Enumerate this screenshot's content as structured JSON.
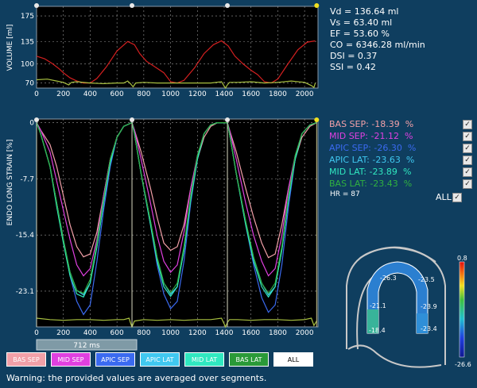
{
  "stats": [
    {
      "label": "Vd",
      "value": "136.64 ml"
    },
    {
      "label": "Vs",
      "value": "63.40 ml"
    },
    {
      "label": "EF",
      "value": "53.60 %"
    },
    {
      "label": "CO",
      "value": "6346.28 ml/min"
    },
    {
      "label": "DSI",
      "value": "0.37"
    },
    {
      "label": "SSI",
      "value": "0.42"
    }
  ],
  "segments": [
    {
      "name": "BAS SEP",
      "value": "-18.39",
      "unit": "%",
      "color": "#f2a0a8",
      "checked": true
    },
    {
      "name": "MID SEP",
      "value": "-21.12",
      "unit": "%",
      "color": "#e040e0",
      "checked": true
    },
    {
      "name": "APIC SEP",
      "value": "-26.30",
      "unit": "%",
      "color": "#3a6af0",
      "checked": true
    },
    {
      "name": "APIC LAT",
      "value": "-23.63",
      "unit": "%",
      "color": "#40c8f0",
      "checked": true
    },
    {
      "name": "MID LAT",
      "value": "-23.89",
      "unit": "%",
      "color": "#30e8c0",
      "checked": true
    },
    {
      "name": "BAS LAT",
      "value": "-23.43",
      "unit": "%",
      "color": "#30b040",
      "checked": true
    }
  ],
  "hr": "HR = 87",
  "all_label": "ALL",
  "check_glyph": "✓",
  "interval_label": "712 ms",
  "warning": "Warning: the provided values are averaged over segments.",
  "buttons": [
    {
      "label": "BAS SEP",
      "bg": "#f2a0a8",
      "fg": "#ffffff"
    },
    {
      "label": "MID SEP",
      "bg": "#e040e0",
      "fg": "#ffffff"
    },
    {
      "label": "APIC SEP",
      "bg": "#3a6af0",
      "fg": "#ffffff"
    },
    {
      "label": "APIC LAT",
      "bg": "#40c8f0",
      "fg": "#ffffff"
    },
    {
      "label": "MID LAT",
      "bg": "#30e8c0",
      "fg": "#ffffff"
    },
    {
      "label": "BAS LAT",
      "bg": "#2a9a38",
      "fg": "#ffffff"
    },
    {
      "label": "ALL",
      "bg": "#ffffff",
      "fg": "#000000"
    }
  ],
  "colorbar": {
    "max_label": "0.8",
    "min_label": "-26.6"
  },
  "bullseye_labels": {
    "sep": [
      "-26.3",
      "-21.1",
      "-18.4"
    ],
    "lat": [
      "-23.5",
      "-23.9",
      "-23.4"
    ]
  },
  "chart_data": [
    {
      "type": "line",
      "ylabel": "VOLUME [ml]",
      "xlim": [
        0,
        2100
      ],
      "ylim": [
        62,
        190
      ],
      "xticks": [
        0,
        200,
        400,
        600,
        800,
        1000,
        1200,
        1400,
        1600,
        1800,
        2000
      ],
      "yticks": [
        70,
        100,
        135,
        175
      ],
      "series": [
        {
          "name": "volume",
          "color": "#d42020",
          "x": [
            0,
            60,
            120,
            170,
            200,
            250,
            300,
            350,
            400,
            450,
            520,
            600,
            680,
            730,
            770,
            820,
            900,
            950,
            1000,
            1050,
            1100,
            1180,
            1250,
            1320,
            1380,
            1430,
            1480,
            1540,
            1600,
            1650,
            1700,
            1750,
            1800,
            1870,
            1950,
            2020,
            2080
          ],
          "values": [
            112,
            108,
            100,
            92,
            86,
            78,
            73,
            70,
            70,
            77,
            95,
            120,
            135,
            130,
            116,
            104,
            93,
            86,
            72,
            70,
            74,
            94,
            116,
            130,
            136,
            128,
            112,
            100,
            90,
            83,
            72,
            70,
            76,
            98,
            122,
            134,
            136
          ]
        },
        {
          "name": "volume-secondary",
          "color": "#a8c040",
          "x": [
            0,
            80,
            150,
            200,
            220,
            240,
            260,
            300,
            400,
            500,
            600,
            650,
            680,
            700,
            720,
            740,
            800,
            900,
            1000,
            1100,
            1200,
            1300,
            1380,
            1400,
            1410,
            1420,
            1440,
            1500,
            1600,
            1700,
            1800,
            1900,
            2000,
            2050,
            2070,
            2080
          ],
          "values": [
            75,
            76,
            73,
            71,
            69,
            67,
            71,
            72,
            70,
            69,
            70,
            70,
            73,
            69,
            64,
            70,
            71,
            70,
            70,
            70,
            70,
            70,
            72,
            65,
            62,
            66,
            71,
            71,
            72,
            70,
            71,
            73,
            71,
            66,
            63,
            70
          ]
        }
      ]
    },
    {
      "type": "line",
      "ylabel": "ENDO LONG STRAIN [%]",
      "xlim": [
        0,
        2100
      ],
      "ylim": [
        -28,
        0.5
      ],
      "xticks": [
        0,
        200,
        400,
        600,
        800,
        1000,
        1200,
        1400,
        1600,
        1800,
        2000
      ],
      "yticks": [
        0,
        -7.7,
        -15.4,
        -23.1
      ],
      "markers": [
        0,
        712,
        1424,
        2090
      ],
      "series": [
        {
          "name": "BAS SEP",
          "color": "#f2a0a8",
          "x": [
            0,
            30,
            100,
            150,
            200,
            250,
            300,
            350,
            400,
            450,
            500,
            550,
            600,
            650,
            712,
            730,
            780,
            850,
            900,
            950,
            1000,
            1050,
            1100,
            1150,
            1200,
            1250,
            1300,
            1350,
            1424,
            1440,
            1490,
            1560,
            1620,
            1680,
            1730,
            1780,
            1830,
            1880,
            1930,
            1980,
            2040,
            2090
          ],
          "values": [
            0,
            -1,
            -3,
            -6,
            -10,
            -14,
            -17,
            -18.4,
            -18,
            -15,
            -10,
            -5,
            -2,
            -0.5,
            0,
            -1,
            -4,
            -9,
            -13,
            -16.5,
            -17.5,
            -17,
            -14,
            -9,
            -5,
            -2,
            -0.5,
            0,
            0,
            -1,
            -4,
            -9,
            -13,
            -16.5,
            -18.5,
            -18,
            -14,
            -9,
            -5,
            -2,
            -0.5,
            0
          ]
        },
        {
          "name": "MID SEP",
          "color": "#e040e0",
          "x": [
            0,
            30,
            100,
            150,
            200,
            250,
            300,
            350,
            400,
            450,
            500,
            550,
            600,
            650,
            712,
            730,
            780,
            850,
            900,
            950,
            1000,
            1050,
            1100,
            1150,
            1200,
            1250,
            1300,
            1350,
            1424,
            1440,
            1490,
            1560,
            1620,
            1680,
            1730,
            1780,
            1830,
            1880,
            1930,
            1980,
            2040,
            2090
          ],
          "values": [
            0,
            -1,
            -4,
            -8,
            -12,
            -16,
            -19.5,
            -21,
            -20,
            -16,
            -10,
            -5,
            -2,
            -0.5,
            0,
            -1,
            -5,
            -11,
            -15.5,
            -19,
            -20.5,
            -19.5,
            -15,
            -9,
            -4.5,
            -1.5,
            -0.3,
            0,
            0,
            -1,
            -5,
            -11,
            -15.5,
            -19,
            -21,
            -20,
            -15.5,
            -9,
            -4.5,
            -1.5,
            -0.3,
            0
          ]
        },
        {
          "name": "APIC SEP",
          "color": "#3a6af0",
          "x": [
            0,
            30,
            100,
            150,
            200,
            250,
            300,
            350,
            400,
            450,
            500,
            550,
            600,
            650,
            712,
            730,
            780,
            850,
            900,
            950,
            1000,
            1050,
            1100,
            1150,
            1200,
            1250,
            1300,
            1350,
            1424,
            1440,
            1490,
            1560,
            1620,
            1680,
            1730,
            1780,
            1830,
            1880,
            1930,
            1980,
            2040,
            2090
          ],
          "values": [
            0,
            -1.5,
            -6,
            -11,
            -16,
            -21,
            -24.5,
            -26.3,
            -25,
            -19,
            -12,
            -6,
            -2,
            -0.5,
            0,
            -1.5,
            -7,
            -14,
            -19.5,
            -23.5,
            -25.5,
            -24.5,
            -19,
            -11,
            -5,
            -1.5,
            -0.3,
            0,
            0,
            -1.5,
            -7,
            -14,
            -19.5,
            -24,
            -26,
            -25,
            -19.5,
            -11.5,
            -5,
            -1.5,
            -0.3,
            0
          ]
        },
        {
          "name": "APIC LAT",
          "color": "#40c8f0",
          "x": [
            0,
            30,
            100,
            150,
            200,
            250,
            300,
            350,
            400,
            450,
            500,
            550,
            600,
            650,
            712,
            730,
            780,
            850,
            900,
            950,
            1000,
            1050,
            1100,
            1150,
            1200,
            1250,
            1300,
            1350,
            1424,
            1440,
            1490,
            1560,
            1620,
            1680,
            1730,
            1780,
            1830,
            1880,
            1930,
            1980,
            2040,
            2090
          ],
          "values": [
            0,
            -1.5,
            -6,
            -11,
            -16,
            -20.5,
            -23,
            -23.6,
            -22,
            -17,
            -11,
            -5.5,
            -2,
            -0.5,
            0,
            -1.5,
            -7,
            -13.5,
            -18.5,
            -22,
            -23.5,
            -22.5,
            -17.5,
            -10.5,
            -5,
            -1.5,
            -0.3,
            0,
            0,
            -1.5,
            -7,
            -13.5,
            -18.5,
            -22,
            -23.6,
            -22.5,
            -17.5,
            -10.5,
            -5,
            -1.5,
            -0.3,
            0
          ]
        },
        {
          "name": "MID LAT",
          "color": "#30e8c0",
          "x": [
            0,
            30,
            100,
            150,
            200,
            250,
            300,
            350,
            400,
            450,
            500,
            550,
            600,
            650,
            712,
            730,
            780,
            850,
            900,
            950,
            1000,
            1050,
            1100,
            1150,
            1200,
            1250,
            1300,
            1350,
            1424,
            1440,
            1490,
            1560,
            1620,
            1680,
            1730,
            1780,
            1830,
            1880,
            1930,
            1980,
            2040,
            2090
          ],
          "values": [
            0,
            -1.5,
            -6,
            -11.5,
            -16.5,
            -21,
            -23.5,
            -23.9,
            -22,
            -17,
            -11,
            -5.5,
            -2,
            -0.5,
            0,
            -1.5,
            -7,
            -14,
            -19,
            -22.5,
            -23.8,
            -22.5,
            -17.5,
            -10.5,
            -5,
            -1.5,
            -0.3,
            0,
            0,
            -1.5,
            -7,
            -14,
            -19,
            -22.5,
            -23.9,
            -22.5,
            -17.5,
            -10.5,
            -5,
            -1.5,
            -0.3,
            0
          ]
        },
        {
          "name": "BAS LAT",
          "color": "#30b040",
          "x": [
            0,
            30,
            100,
            150,
            200,
            250,
            300,
            350,
            400,
            450,
            500,
            550,
            600,
            650,
            712,
            730,
            780,
            850,
            900,
            950,
            1000,
            1050,
            1100,
            1150,
            1200,
            1250,
            1300,
            1350,
            1424,
            1440,
            1490,
            1560,
            1620,
            1680,
            1730,
            1780,
            1830,
            1880,
            1930,
            1980,
            2040,
            2090
          ],
          "values": [
            0,
            -1.5,
            -6,
            -11,
            -16,
            -20.5,
            -23,
            -23.4,
            -21.5,
            -16.5,
            -10.5,
            -5,
            -2,
            -0.5,
            0,
            -1.5,
            -7,
            -13.5,
            -18.5,
            -22,
            -23.3,
            -22,
            -17,
            -10,
            -4.5,
            -1.5,
            -0.3,
            0,
            0,
            -1.5,
            -7,
            -13.5,
            -18.5,
            -22,
            -23.4,
            -22,
            -17,
            -10,
            -4.5,
            -1.5,
            -0.3,
            0
          ]
        },
        {
          "name": "ecg",
          "color": "#a8c040",
          "x": [
            0,
            100,
            200,
            300,
            400,
            500,
            600,
            650,
            690,
            700,
            712,
            730,
            800,
            900,
            1000,
            1100,
            1200,
            1300,
            1380,
            1400,
            1410,
            1424,
            1440,
            1500,
            1600,
            1700,
            1800,
            1900,
            2000,
            2050,
            2070,
            2090
          ],
          "values": [
            -26.8,
            -27,
            -27.1,
            -27,
            -27,
            -27.1,
            -27,
            -27,
            -26.8,
            -27.4,
            -28,
            -27.2,
            -27,
            -27.1,
            -27,
            -27.1,
            -27,
            -27,
            -26.8,
            -27.6,
            -28,
            -27.4,
            -27,
            -27,
            -27.1,
            -27,
            -27,
            -27.1,
            -27,
            -26.8,
            -27.8,
            -27.2
          ]
        }
      ]
    }
  ]
}
